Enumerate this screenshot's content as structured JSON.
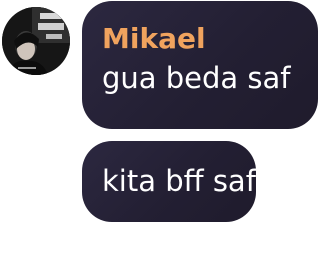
{
  "messages": [
    {
      "sender": "Mikael",
      "text": "gua beda saf",
      "avatar_icon": "user-avatar"
    },
    {
      "text": "kita bff saf"
    }
  ],
  "colors": {
    "bubble_background": "#27233a",
    "sender_name": "#f0a35e",
    "message_text": "#ffffff",
    "page_background": "#ffffff"
  }
}
